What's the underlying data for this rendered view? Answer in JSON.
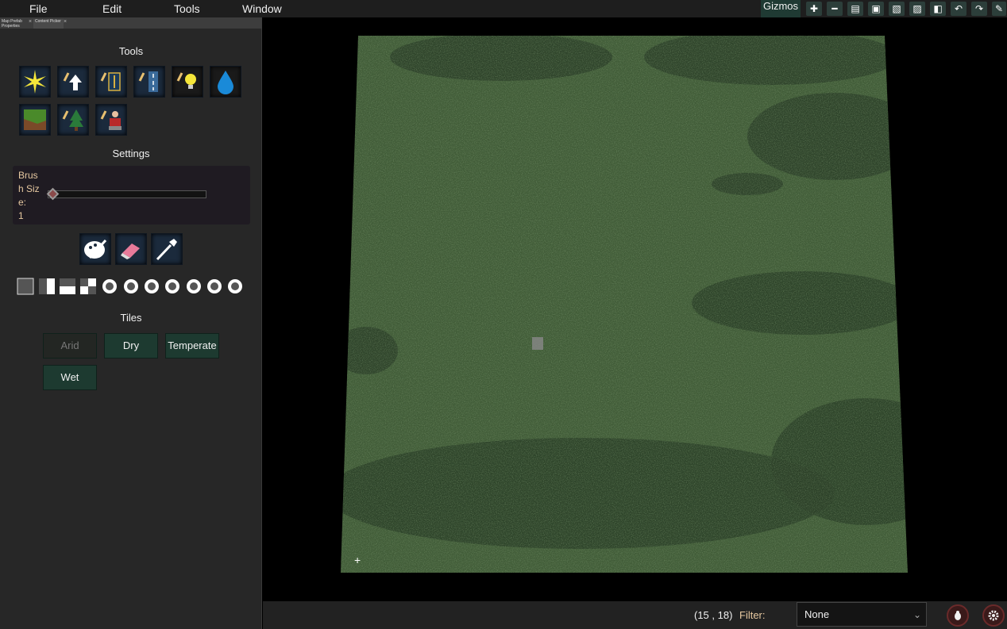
{
  "menu": {
    "items": [
      "File",
      "Edit",
      "Tools",
      "Window"
    ],
    "gizmos_label": "Gizmos"
  },
  "toolbar_icons": [
    "add-icon",
    "minus-icon",
    "new-file-icon",
    "save-icon",
    "save-as-icon",
    "export-icon",
    "import-icon",
    "undo-icon",
    "redo-icon",
    "pencil-icon",
    "refresh-icon"
  ],
  "panel": {
    "tabs": [
      "Map Prefab Properties",
      "Content Picker"
    ],
    "tools_title": "Tools",
    "tools": [
      "light-burst-icon",
      "raise-icon",
      "faction-banner-icon",
      "road-icon",
      "light-bulb-icon",
      "water-drop-icon",
      "terrain-tile-icon",
      "tree-icon",
      "unit-icon"
    ],
    "settings_title": "Settings",
    "brush_label": "Brush Size:",
    "brush_value": "1",
    "brush_level": 0.0,
    "paint_tools": [
      "paint-palette-icon",
      "eraser-icon",
      "eyedropper-icon"
    ],
    "symmetry_modes": [
      "none",
      "horizontal",
      "vertical",
      "quad",
      "rot-2",
      "rot-3",
      "rot-4",
      "rot-5",
      "rot-6",
      "rot-8"
    ],
    "tiles_title": "Tiles",
    "tiles": [
      {
        "label": "Arid",
        "disabled": true
      },
      {
        "label": "Dry",
        "disabled": false
      },
      {
        "label": "Temperate",
        "disabled": false
      },
      {
        "label": "Wet",
        "disabled": false
      }
    ]
  },
  "status": {
    "coords": "(15 , 18)",
    "filter_label": "Filter:",
    "filter_value": "None"
  },
  "colors": {
    "accent": "#1d3a30",
    "grass": "#3e5a36",
    "shadow": "#253722"
  }
}
